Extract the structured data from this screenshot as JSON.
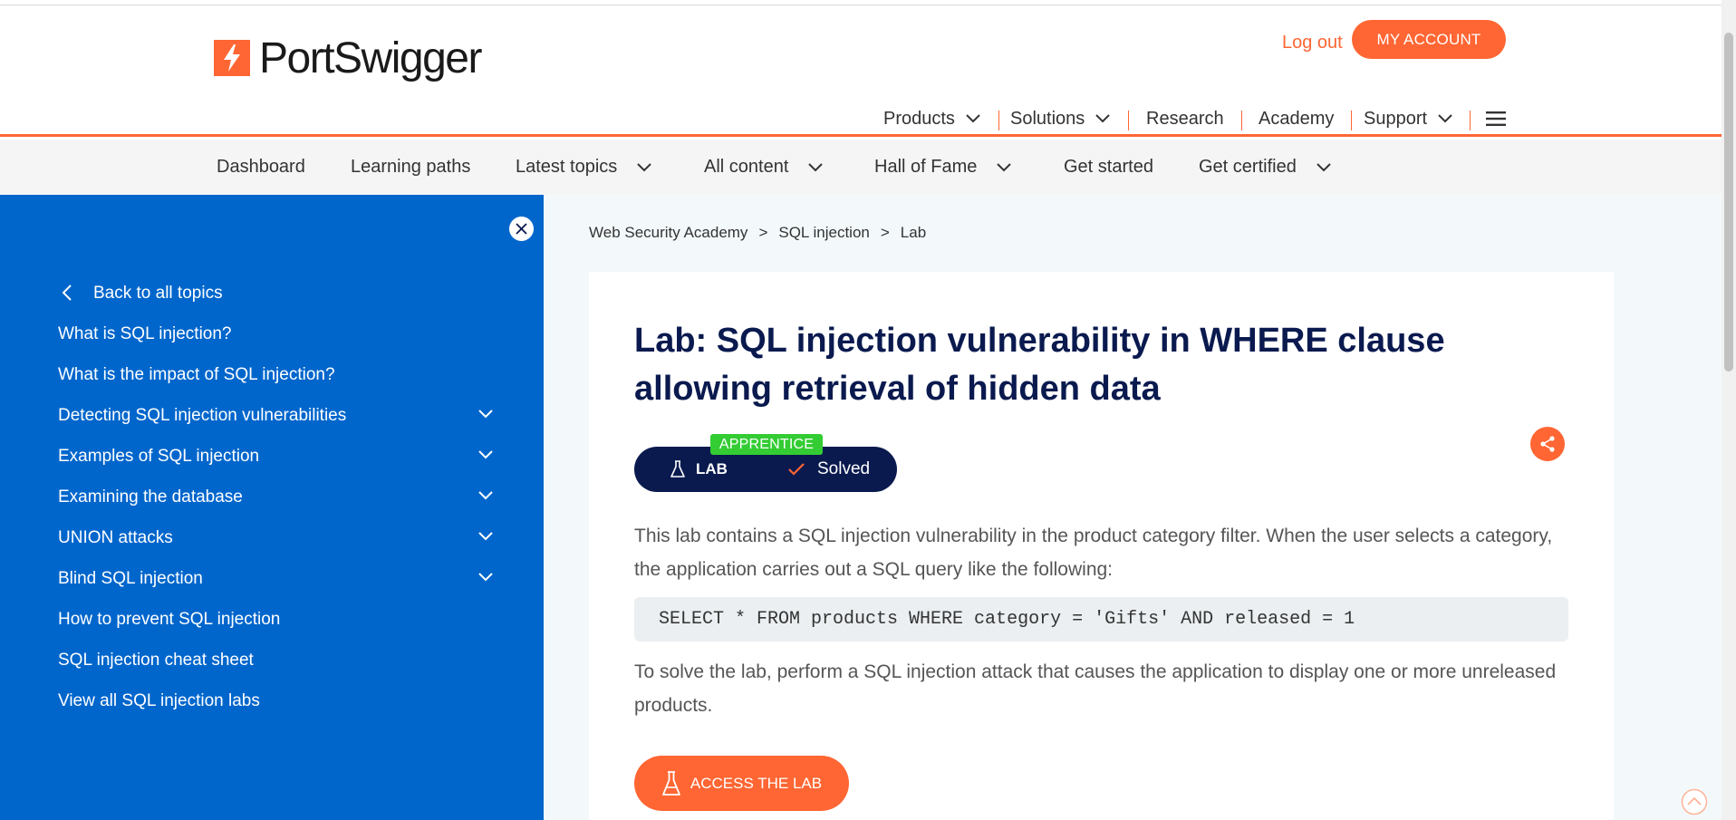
{
  "header": {
    "brand": "PortSwigger",
    "logout_label": "Log out",
    "account_label": "MY ACCOUNT",
    "accent_color": "#ff6633",
    "nav": [
      {
        "label": "Products",
        "has_dropdown": true
      },
      {
        "label": "Solutions",
        "has_dropdown": true
      },
      {
        "label": "Research",
        "has_dropdown": false
      },
      {
        "label": "Academy",
        "has_dropdown": false
      },
      {
        "label": "Support",
        "has_dropdown": true
      }
    ],
    "menu_icon": "hamburger-icon"
  },
  "subnav": {
    "items": [
      {
        "label": "Dashboard",
        "has_dropdown": false
      },
      {
        "label": "Learning paths",
        "has_dropdown": false
      },
      {
        "label": "Latest topics",
        "has_dropdown": true
      },
      {
        "label": "All content",
        "has_dropdown": true
      },
      {
        "label": "Hall of Fame",
        "has_dropdown": true
      },
      {
        "label": "Get started",
        "has_dropdown": false
      },
      {
        "label": "Get certified",
        "has_dropdown": true
      }
    ]
  },
  "sidebar": {
    "background": "#0066cc",
    "back_label": "Back to all topics",
    "items": [
      {
        "label": "What is SQL injection?",
        "expandable": false
      },
      {
        "label": "What is the impact of SQL injection?",
        "expandable": false
      },
      {
        "label": "Detecting SQL injection vulnerabilities",
        "expandable": true
      },
      {
        "label": "Examples of SQL injection",
        "expandable": true
      },
      {
        "label": "Examining the database",
        "expandable": true
      },
      {
        "label": "UNION attacks",
        "expandable": true
      },
      {
        "label": "Blind SQL injection",
        "expandable": true
      },
      {
        "label": "How to prevent SQL injection",
        "expandable": false
      },
      {
        "label": "SQL injection cheat sheet",
        "expandable": false
      },
      {
        "label": "View all SQL injection labs",
        "expandable": false
      }
    ]
  },
  "breadcrumb": [
    "Web Security Academy",
    "SQL injection",
    "Lab"
  ],
  "lab": {
    "title": "Lab: SQL injection vulnerability in WHERE clause allowing retrieval of hidden data",
    "level": "APPRENTICE",
    "badge_label": "LAB",
    "status": "Solved",
    "description_1": "This lab contains a SQL injection vulnerability in the product category filter. When the user selects a category, the application carries out a SQL query like the following:",
    "code": "SELECT * FROM products WHERE category = 'Gifts' AND released = 1",
    "description_2": "To solve the lab, perform a SQL injection attack that causes the application to display one or more unreleased products.",
    "access_label": "ACCESS THE LAB"
  }
}
